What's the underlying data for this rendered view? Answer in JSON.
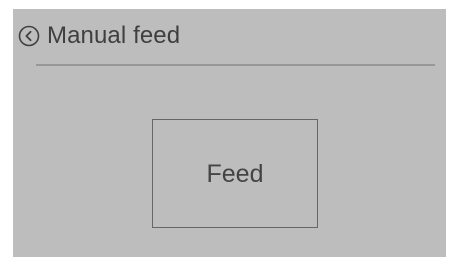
{
  "header": {
    "title": "Manual feed",
    "back_icon": "chevron-left-circle-icon"
  },
  "main": {
    "feed_label": "Feed"
  },
  "colors": {
    "panel_background": "#bdbdbd",
    "text": "#3f3f3f",
    "divider": "#989898",
    "button_border": "#666666"
  }
}
